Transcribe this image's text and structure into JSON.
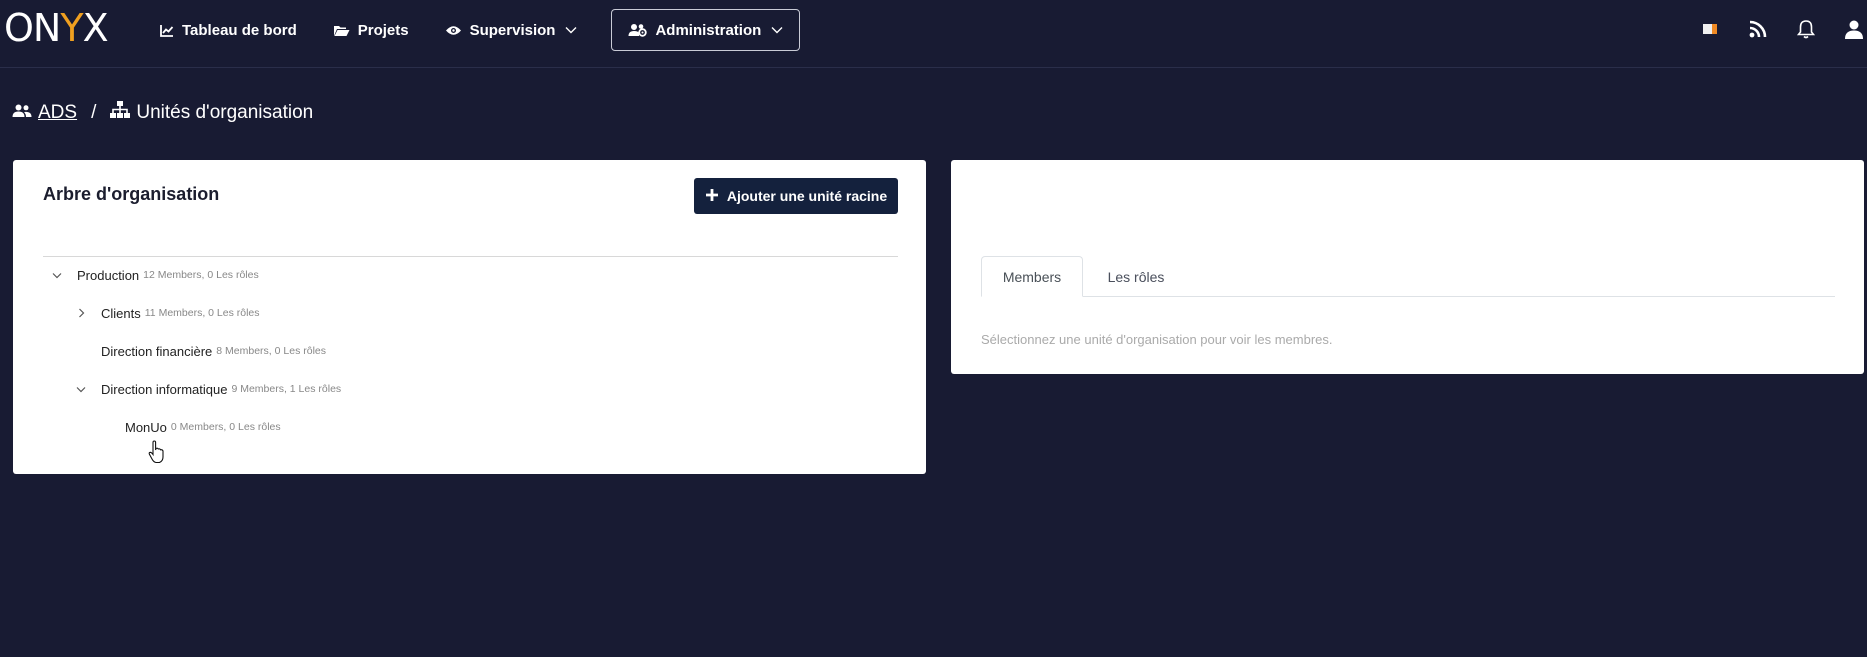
{
  "app": {
    "logo_text_1": "ON",
    "logo_text_y": "Y",
    "logo_text_2": "X",
    "accent_color": "#f0a020"
  },
  "nav": {
    "items": [
      {
        "label": "Tableau de bord",
        "icon": "line-chart-icon"
      },
      {
        "label": "Projets",
        "icon": "folder-open-icon"
      },
      {
        "label": "Supervision",
        "icon": "eye-icon",
        "has_dropdown": true
      },
      {
        "label": "Administration",
        "icon": "users-cog-icon",
        "has_dropdown": true,
        "active": true
      }
    ],
    "right_icons": [
      "flag-icon",
      "rss-icon",
      "bell-icon",
      "user-icon"
    ]
  },
  "breadcrumb": {
    "root": "ADS",
    "separator": "/",
    "current": "Unités d'organisation"
  },
  "tree_panel": {
    "title": "Arbre d'organisation",
    "add_button_label": "Ajouter une unité racine",
    "nodes": [
      {
        "name": "Production",
        "meta": "12 Members, 0 Les rôles",
        "expanded": true,
        "level": 0
      },
      {
        "name": "Clients",
        "meta": "11 Members, 0 Les rôles",
        "expanded": false,
        "level": 1
      },
      {
        "name": "Direction financière",
        "meta": "8 Members, 0 Les rôles",
        "level": 1
      },
      {
        "name": "Direction informatique",
        "meta": "9 Members, 1 Les rôles",
        "expanded": true,
        "level": 1
      },
      {
        "name": "MonUo",
        "meta": "0 Members, 0 Les rôles",
        "level": 2
      }
    ]
  },
  "detail_panel": {
    "tabs": [
      {
        "label": "Members",
        "active": true
      },
      {
        "label": "Les rôles",
        "active": false
      }
    ],
    "empty_message": "Sélectionnez une unité d'organisation pour voir les membres."
  }
}
